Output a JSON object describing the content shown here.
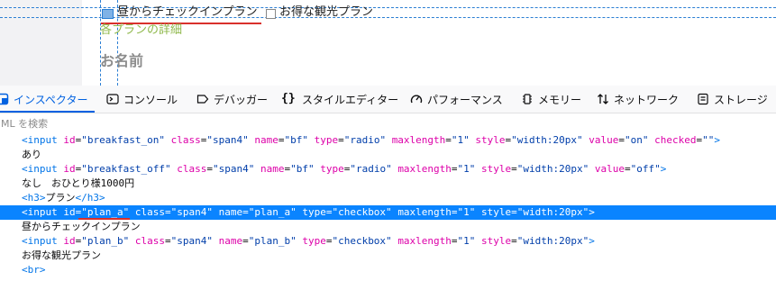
{
  "preview": {
    "plan_a_label": "昼からチェックインプラン",
    "plan_b_label": "お得な観光プラン",
    "plan_detail": "各プランの詳細",
    "name_heading": "お名前"
  },
  "devtools": {
    "tabs": [
      {
        "label": "インスペクター",
        "icon": "inspector-icon",
        "active": true
      },
      {
        "label": "コンソール",
        "icon": "console-icon"
      },
      {
        "label": "デバッガー",
        "icon": "debugger-icon"
      },
      {
        "label": "スタイルエディター",
        "icon": "style-editor-icon"
      },
      {
        "label": "パフォーマンス",
        "icon": "performance-icon"
      },
      {
        "label": "メモリー",
        "icon": "memory-icon"
      },
      {
        "label": "ネットワーク",
        "icon": "network-icon"
      },
      {
        "label": "ストレージ",
        "icon": "storage-icon"
      }
    ],
    "search_placeholder": "ML を検索",
    "accent_color": "#0061e0",
    "selection_color": "#0a84ff"
  },
  "markup": {
    "line1": {
      "tag_open": "<input",
      "a1": "id",
      "v1": "\"breakfast_on\"",
      "a2": "class",
      "v2": "\"span4\"",
      "a3": "name",
      "v3": "\"bf\"",
      "a4": "type",
      "v4": "\"radio\"",
      "a5": "maxlength",
      "v5": "\"1\"",
      "a6": "style",
      "v6": "\"width:20px\"",
      "a7": "value",
      "v7": "\"on\"",
      "a8": "checked",
      "v8": "\"\"",
      "tag_close": ">"
    },
    "line2": "あり",
    "line3": {
      "tag_open": "<input",
      "a1": "id",
      "v1": "\"breakfast_off\"",
      "a2": "class",
      "v2": "\"span4\"",
      "a3": "name",
      "v3": "\"bf\"",
      "a4": "type",
      "v4": "\"radio\"",
      "a5": "maxlength",
      "v5": "\"1\"",
      "a6": "style",
      "v6": "\"width:20px\"",
      "a7": "value",
      "v7": "\"off\"",
      "tag_close": ">"
    },
    "line4": "なし　おひとり様1000円",
    "line5": {
      "open": "<h3>",
      "text": "プラン",
      "close": "</h3>"
    },
    "line6": {
      "tag_open": "<input",
      "a1": "id",
      "v1": "\"plan_a\"",
      "a2": "class",
      "v2": "\"span4\"",
      "a3": "name",
      "v3": "\"plan_a\"",
      "a4": "type",
      "v4": "\"checkbox\"",
      "a5": "maxlength",
      "v5": "\"1\"",
      "a6": "style",
      "v6": "\"width:20px\"",
      "tag_close": ">"
    },
    "line7": "昼からチェックインプラン",
    "line8": {
      "tag_open": "<input",
      "a1": "id",
      "v1": "\"plan_b\"",
      "a2": "class",
      "v2": "\"span4\"",
      "a3": "name",
      "v3": "\"plan_b\"",
      "a4": "type",
      "v4": "\"checkbox\"",
      "a5": "maxlength",
      "v5": "\"1\"",
      "a6": "style",
      "v6": "\"width:20px\"",
      "tag_close": ">"
    },
    "line9": "お得な観光プラン",
    "line10": "<br>"
  }
}
